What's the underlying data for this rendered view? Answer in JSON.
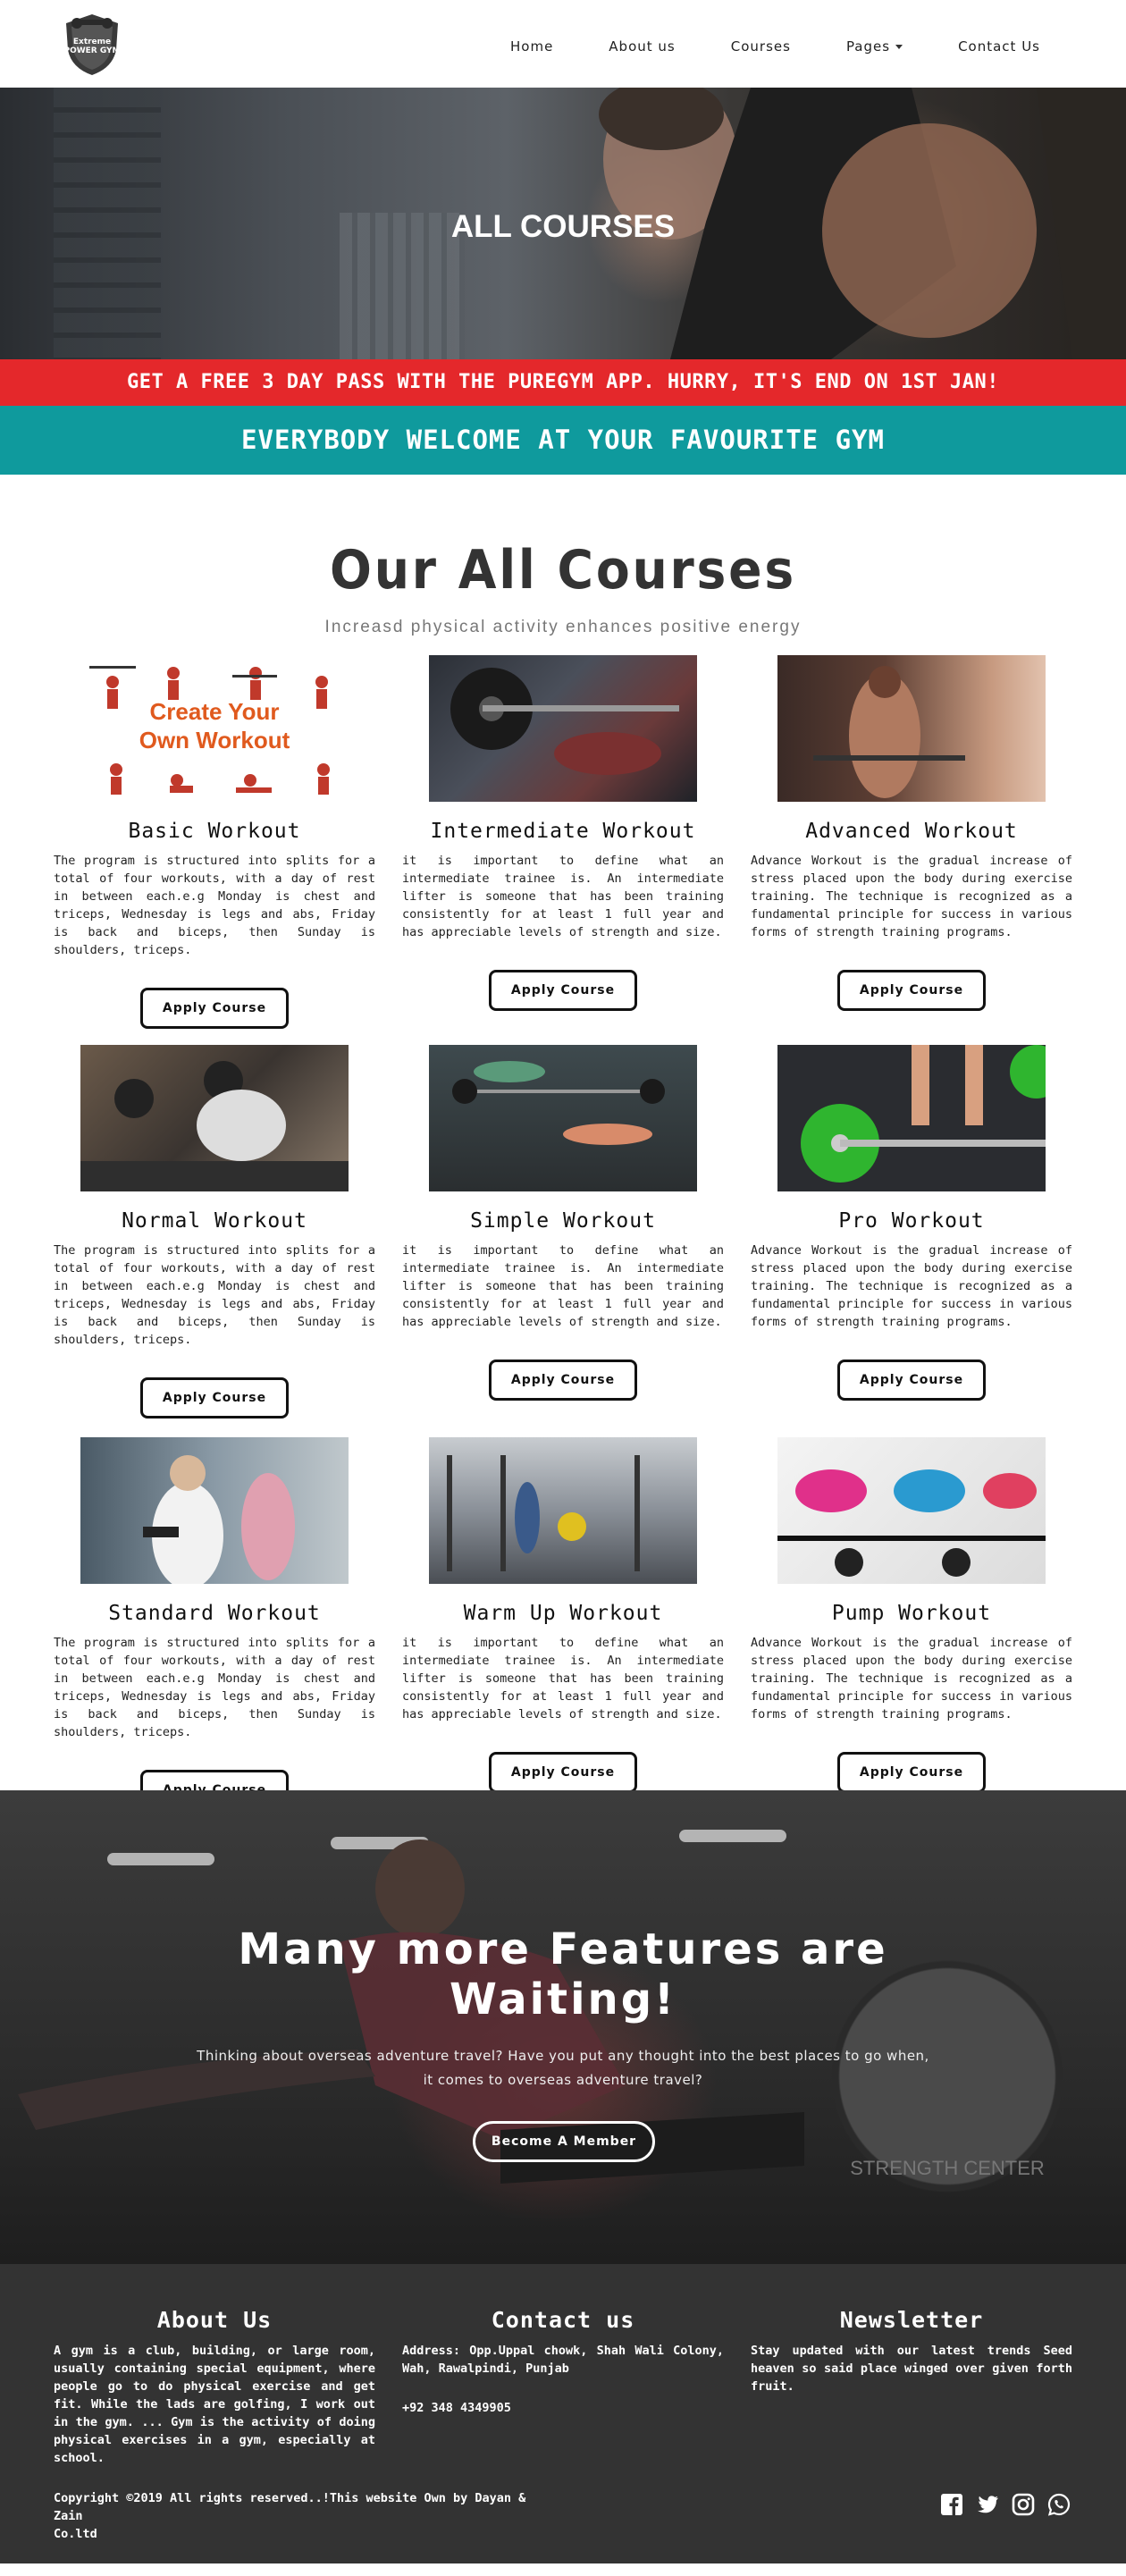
{
  "nav": {
    "logo_text": "Extreme POWER GYM",
    "links": [
      "Home",
      "About us",
      "Courses",
      "Pages",
      "Contact Us"
    ]
  },
  "hero": {
    "title": "ALL COURSES"
  },
  "promo": {
    "text": "GET A FREE 3 DAY PASS WITH THE PUREGYM APP. HURRY, IT'S END ON 1ST JAN!"
  },
  "welcome": {
    "text": "EVERYBODY WELCOME AT YOUR FAVOURITE GYM"
  },
  "courses": {
    "heading": "Our All Courses",
    "subheading": "Increasd physical activity enhances positive energy",
    "button_label": "Apply Course",
    "items": [
      {
        "title": "Basic Workout",
        "text": "The program is structured into splits for a total of four workouts, with a day of rest in between each.e.g Monday is chest and triceps, Wednesday is legs and abs, Friday is back and biceps, then Sunday is shoulders, triceps.",
        "image_text": "Create Your Own Workout"
      },
      {
        "title": "Intermediate Workout",
        "text": "it is important to define what an intermediate trainee is. An intermediate lifter is someone that has been training consistently for at least 1 full year and has appreciable levels of strength and size."
      },
      {
        "title": "Advanced Workout",
        "text": "Advance Workout is the gradual increase of stress placed upon the body during exercise training. The technique is recognized as a fundamental principle for success in various forms of strength training programs."
      },
      {
        "title": "Normal Workout",
        "text": "The program is structured into splits for a total of four workouts, with a day of rest in between each.e.g Monday is chest and triceps, Wednesday is legs and abs, Friday is back and biceps, then Sunday is shoulders, triceps."
      },
      {
        "title": "Simple Workout",
        "text": "it is important to define what an intermediate trainee is. An intermediate lifter is someone that has been training consistently for at least 1 full year and has appreciable levels of strength and size."
      },
      {
        "title": "Pro Workout",
        "text": "Advance Workout is the gradual increase of stress placed upon the body during exercise training. The technique is recognized as a fundamental principle for success in various forms of strength training programs."
      },
      {
        "title": "Standard Workout",
        "text": "The program is structured into splits for a total of four workouts, with a day of rest in between each.e.g Monday is chest and triceps, Wednesday is legs and abs, Friday is back and biceps, then Sunday is shoulders, triceps."
      },
      {
        "title": "Warm Up Workout",
        "text": "it is important to define what an intermediate trainee is. An intermediate lifter is someone that has been training consistently for at least 1 full year and has appreciable levels of strength and size."
      },
      {
        "title": "Pump Workout",
        "text": "Advance Workout is the gradual increase of stress placed upon the body during exercise training. The technique is recognized as a fundamental principle for success in various forms of strength training programs."
      }
    ]
  },
  "banner": {
    "title_line1": "Many more Features are",
    "title_line2": "Waiting!",
    "text_line1": "Thinking about overseas adventure travel? Have you put any thought into the best places to go when,",
    "text_line2": "it comes to overseas adventure travel?",
    "button_label": "Become A Member"
  },
  "footer": {
    "about": {
      "title": "About Us",
      "text": "A gym is a club, building, or large room, usually containing special equipment, where people go to do physical exercise and get fit. While the lads are golfing, I work out in the gym. ... Gym is the activity of doing physical exercises in a gym, especially at school."
    },
    "contact": {
      "title": "Contact us",
      "address": "Address: Opp.Uppal chowk, Shah Wali Colony, Wah, Rawalpindi, Punjab",
      "phone": "+92 348 4349905"
    },
    "newsletter": {
      "title": "Newsletter",
      "text": "Stay updated with our latest trends Seed heaven so said place winged over given forth fruit."
    },
    "copyright_line1": "Copyright ©2019 All rights reserved..!This website Own by Dayan & Zain",
    "copyright_line2": "Co.ltd",
    "social_icons": [
      "facebook-icon",
      "twitter-icon",
      "instagram-icon",
      "whatsapp-icon"
    ]
  },
  "colors": {
    "promo_red": "#e4282b",
    "welcome_teal": "#0f9a9d",
    "footer_bg": "#333333"
  }
}
